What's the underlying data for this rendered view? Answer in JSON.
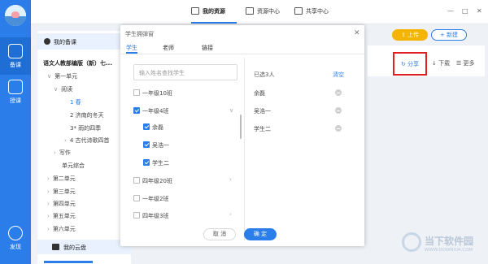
{
  "rail": {
    "items": [
      {
        "label": "备课"
      },
      {
        "label": "授课"
      },
      {
        "label": "发现"
      }
    ]
  },
  "topbar": {
    "tabs": [
      {
        "label": "我的资源"
      },
      {
        "label": "资源中心"
      },
      {
        "label": "共享中心"
      }
    ],
    "window_controls": [
      "—",
      "□",
      "✕"
    ]
  },
  "tree": {
    "my_lesson": "我的备课",
    "book_title": "语文人教部编版（新）七...",
    "nodes": [
      {
        "label": "第一单元",
        "arrow": "∨"
      },
      {
        "label": "阅读",
        "arrow": "∨"
      },
      {
        "label": "1 春",
        "arrow": ""
      },
      {
        "label": "2 济南的冬天",
        "arrow": ""
      },
      {
        "label": "3* 雨的四季",
        "arrow": ""
      },
      {
        "label": "4 古代诗歌四首",
        "arrow": "›"
      },
      {
        "label": "写作",
        "arrow": "›"
      },
      {
        "label": "单元综合",
        "arrow": ""
      },
      {
        "label": "第二单元",
        "arrow": "›"
      },
      {
        "label": "第三单元",
        "arrow": "›"
      },
      {
        "label": "第四单元",
        "arrow": "›"
      },
      {
        "label": "第五单元",
        "arrow": "›"
      },
      {
        "label": "第六单元",
        "arrow": "›"
      }
    ],
    "cloud": "我的云盘"
  },
  "actions": {
    "upload": "上传",
    "new": "新建",
    "share": "分享",
    "download": "下载",
    "more": "更多"
  },
  "modal": {
    "title": "学生拥弹窗",
    "close": "✕",
    "tabs": [
      {
        "label": "学生"
      },
      {
        "label": "老师"
      },
      {
        "label": "链接"
      }
    ],
    "search_placeholder": "输入姓名查找学生",
    "list": [
      {
        "label": "一年级10班",
        "checked": false
      },
      {
        "label": "一年级4班",
        "checked": true
      },
      {
        "label": "余磊",
        "checked": true
      },
      {
        "label": "吴浩一",
        "checked": true
      },
      {
        "label": "学生二",
        "checked": true
      },
      {
        "label": "四年级20班",
        "checked": false
      },
      {
        "label": "一年级2班",
        "checked": false
      },
      {
        "label": "四年级3班",
        "checked": false
      }
    ],
    "selected_header": "已选3人",
    "clear": "清空",
    "selected": [
      "余磊",
      "吴浩一",
      "学生二"
    ],
    "cancel": "取 消",
    "confirm": "确 定"
  },
  "watermark": {
    "title": "当下软件园",
    "url": "WWW.DOWNXIA.COM"
  },
  "colors": {
    "accent": "#2b7de9",
    "upload": "#f4b400",
    "highlight": "#e02020"
  }
}
